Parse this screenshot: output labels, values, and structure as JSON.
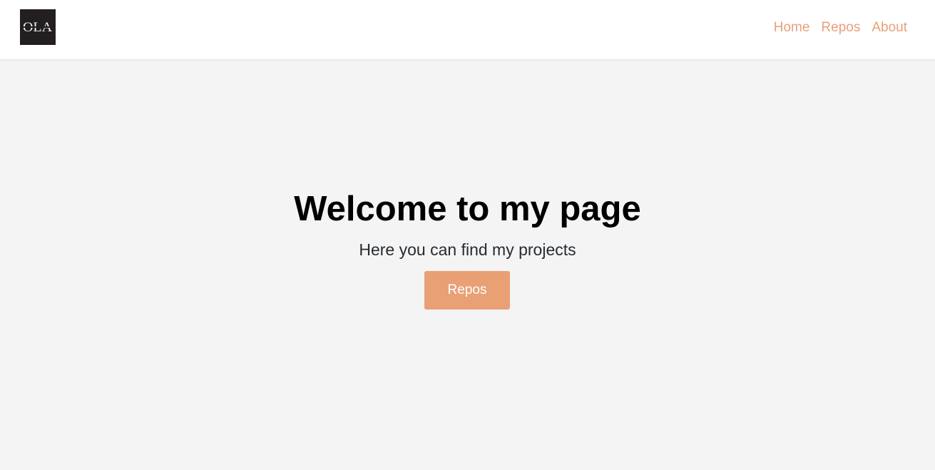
{
  "header": {
    "logo_text": "OLA",
    "nav": [
      {
        "label": "Home"
      },
      {
        "label": "Repos"
      },
      {
        "label": "About"
      }
    ]
  },
  "hero": {
    "title": "Welcome to my page",
    "subtitle": "Here you can find my projects",
    "button_label": "Repos"
  },
  "colors": {
    "accent": "#e9a075",
    "background": "#f4f4f4",
    "header_bg": "#ffffff",
    "logo_bg": "#231f20"
  }
}
